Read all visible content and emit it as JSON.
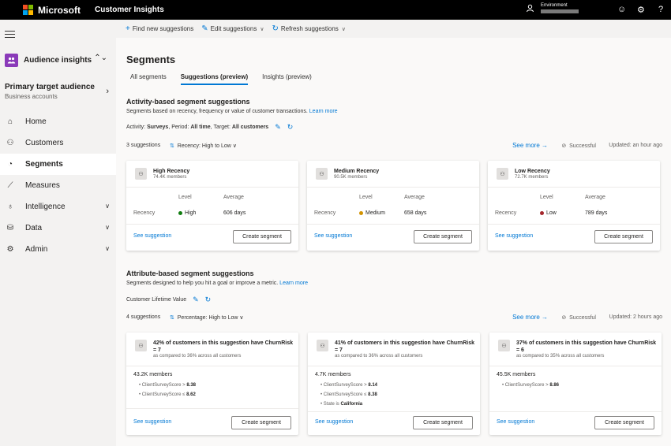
{
  "topbar": {
    "brand": "Microsoft",
    "app_name": "Customer Insights",
    "environment_label": "Environment",
    "icons": [
      "person-icon",
      "smile-icon",
      "gear-icon",
      "help-icon"
    ],
    "logo_colors": [
      "#f25022",
      "#7fba00",
      "#00a4ef",
      "#ffb900"
    ]
  },
  "sidebar": {
    "app_switcher_label": "Audience insights",
    "audience_title": "Primary target audience",
    "audience_sub": "Business accounts",
    "items": [
      {
        "label": "Home",
        "icon": "home-icon",
        "active": false,
        "expandable": false
      },
      {
        "label": "Customers",
        "icon": "people-icon",
        "active": false,
        "expandable": false
      },
      {
        "label": "Segments",
        "icon": "pie-icon",
        "active": true,
        "expandable": false
      },
      {
        "label": "Measures",
        "icon": "chart-icon",
        "active": false,
        "expandable": false
      },
      {
        "label": "Intelligence",
        "icon": "bulb-icon",
        "active": false,
        "expandable": true
      },
      {
        "label": "Data",
        "icon": "database-icon",
        "active": false,
        "expandable": true
      },
      {
        "label": "Admin",
        "icon": "gear-icon",
        "active": false,
        "expandable": true
      }
    ]
  },
  "commandbar": {
    "find_new": "Find new suggestions",
    "edit": "Edit suggestions",
    "refresh": "Refresh suggestions"
  },
  "page": {
    "title": "Segments",
    "tabs": [
      {
        "label": "All segments",
        "active": false
      },
      {
        "label": "Suggestions (preview)",
        "active": true
      },
      {
        "label": "Insights (preview)",
        "active": false
      }
    ]
  },
  "activity": {
    "title": "Activity-based segment suggestions",
    "desc": "Segments based on recency, frequency or value of customer transactions.",
    "learn_more": "Learn more",
    "filter_activity_label": "Activity:",
    "filter_activity": "Surveys",
    "filter_period_label": "Period:",
    "filter_period": "All time",
    "filter_target_label": "Target:",
    "filter_target": "All customers",
    "count": "3 suggestions",
    "sort": "Recency: High to Low",
    "see_more": "See more",
    "status": "Successful",
    "updated": "Updated: an hour ago",
    "cards": [
      {
        "title": "High Recency",
        "members": "74.4K members",
        "level_header": "Level",
        "avg_header": "Average",
        "row_label": "Recency",
        "level": "High",
        "level_color": "#107c10",
        "average": "606 days",
        "see": "See suggestion",
        "create": "Create segment"
      },
      {
        "title": "Medium Recency",
        "members": "90.5K members",
        "level_header": "Level",
        "avg_header": "Average",
        "row_label": "Recency",
        "level": "Medium",
        "level_color": "#d29200",
        "average": "658 days",
        "see": "See suggestion",
        "create": "Create segment"
      },
      {
        "title": "Low Recency",
        "members": "72.7K members",
        "level_header": "Level",
        "avg_header": "Average",
        "row_label": "Recency",
        "level": "Low",
        "level_color": "#a4262c",
        "average": "789 days",
        "see": "See suggestion",
        "create": "Create segment"
      }
    ]
  },
  "attribute": {
    "title": "Attribute-based segment suggestions",
    "desc": "Segments designed to help you hit a goal or improve a metric.",
    "learn_more": "Learn more",
    "metric": "Customer Lifetime Value",
    "count": "4 suggestions",
    "sort": "Percentage: High to Low",
    "see_more": "See more",
    "status": "Successful",
    "updated": "Updated: 2 hours ago",
    "cards": [
      {
        "title_line1": "42% of customers in this suggestion have ChurnRisk",
        "title_line2": "= 7",
        "compare": "as compared to 36% across all customers",
        "members": "43.2K members",
        "rules": [
          {
            "label": "ClientSurveyScore >",
            "value": "8.38"
          },
          {
            "label": "ClientSurveyScore ≤",
            "value": "8.62"
          }
        ],
        "see": "See suggestion",
        "create": "Create segment"
      },
      {
        "title_line1": "41% of customers in this suggestion have ChurnRisk",
        "title_line2": "= 7",
        "compare": "as compared to 36% across all customers",
        "members": "4.7K members",
        "rules": [
          {
            "label": "ClientSurveyScore >",
            "value": "8.14"
          },
          {
            "label": "ClientSurveyScore ≤",
            "value": "8.38"
          },
          {
            "label": "State is",
            "value": "California"
          }
        ],
        "see": "See suggestion",
        "create": "Create segment"
      },
      {
        "title_line1": "37% of customers in this suggestion have ChurnRisk",
        "title_line2": "= 6",
        "compare": "as compared to 35% across all customers",
        "members": "45.5K members",
        "rules": [
          {
            "label": "ClientSurveyScore >",
            "value": "8.86"
          }
        ],
        "see": "See suggestion",
        "create": "Create segment"
      }
    ]
  }
}
